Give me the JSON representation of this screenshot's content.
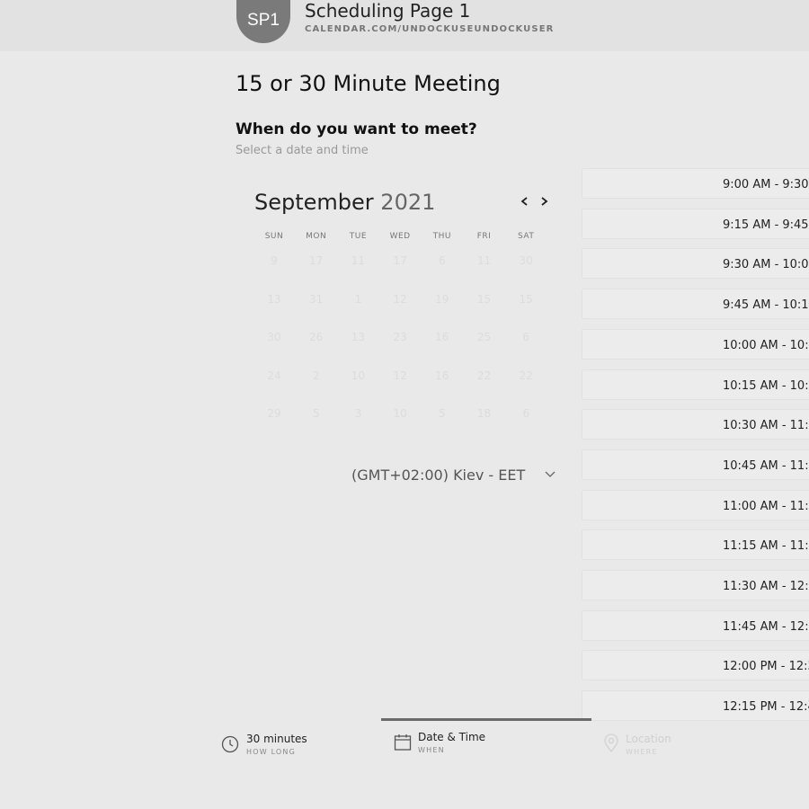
{
  "header": {
    "avatar_initials": "SP1",
    "title": "Scheduling Page 1",
    "url": "CALENDAR.COM/UNDOCKUSEUNDOCKUSER"
  },
  "meeting": {
    "title": "15 or 30 Minute Meeting",
    "question": "When do you want to meet?",
    "subtext": "Select a date and time"
  },
  "calendar": {
    "month": "September",
    "year": "2021",
    "prev_icon": "chevron-left-icon",
    "next_icon": "chevron-right-icon",
    "weekdays": [
      "SUN",
      "MON",
      "TUE",
      "WED",
      "THU",
      "FRI",
      "SAT"
    ],
    "weeks": [
      [
        "9",
        "17",
        "11",
        "17",
        "6",
        "11",
        "30"
      ],
      [
        "13",
        "31",
        "1",
        "12",
        "19",
        "15",
        "15"
      ],
      [
        "30",
        "26",
        "13",
        "23",
        "16",
        "25",
        "6"
      ],
      [
        "24",
        "2",
        "10",
        "12",
        "16",
        "22",
        "22"
      ],
      [
        "29",
        "5",
        "3",
        "10",
        "5",
        "18",
        "6"
      ]
    ]
  },
  "timezone": {
    "label": "(GMT+02:00) Kiev - EET",
    "icon": "chevron-down-icon"
  },
  "time_slots": [
    "9:00 AM - 9:30",
    "9:15 AM - 9:45",
    "9:30 AM - 10:0",
    "9:45 AM - 10:1",
    "10:00 AM - 10:3",
    "10:15 AM - 10:4",
    "10:30 AM - 11:0",
    "10:45 AM - 11:1",
    "11:00 AM - 11:3",
    "11:15 AM - 11:4",
    "11:30 AM - 12:0",
    "11:45 AM - 12:1",
    "12:00 PM - 12:3",
    "12:15 PM - 12:4"
  ],
  "steps": [
    {
      "label": "30 minutes",
      "sub": "HOW LONG",
      "icon": "clock-icon",
      "active": false
    },
    {
      "label": "Date & Time",
      "sub": "WHEN",
      "icon": "calendar-icon",
      "active": true
    },
    {
      "label": "Location",
      "sub": "WHERE",
      "icon": "location-pin-icon",
      "active": false
    }
  ]
}
